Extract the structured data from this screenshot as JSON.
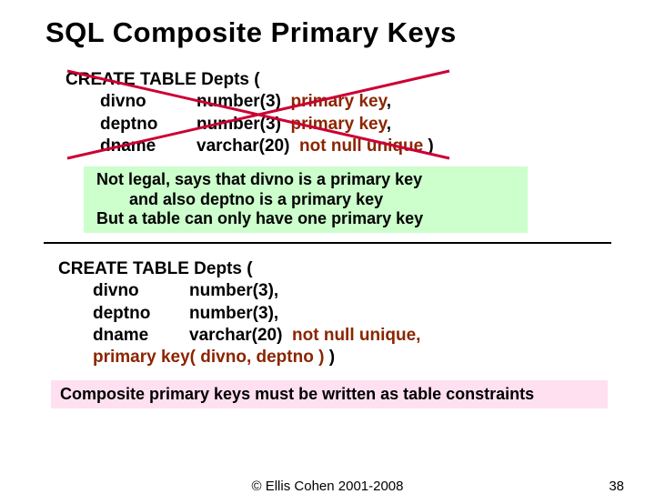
{
  "title": "SQL Composite Primary Keys",
  "block1": {
    "l1": "CREATE TABLE Depts (",
    "c1": "divno",
    "t1a": "number(3)",
    "t1b": "primary key",
    "t1c": ",",
    "c2": "deptno",
    "t2a": "number(3)",
    "t2b": "primary key",
    "t2c": ",",
    "c3": "dname",
    "t3a": "varchar(20)",
    "t3b": "not null  unique",
    "t3c": " )"
  },
  "note1_l1": "Not legal, says that divno is a primary key",
  "note1_l2": "and also deptno is a primary key",
  "note1_l3": "But a table can only have one primary key",
  "block2": {
    "l1": "CREATE TABLE Depts (",
    "c1": "divno",
    "t1": "number(3),",
    "c2": "deptno",
    "t2": "number(3),",
    "c3": "dname",
    "t3a": "varchar(20)",
    "t3b": "not null  unique,",
    "pk": "primary key( divno, deptno )",
    "pkend": " )"
  },
  "note2": "Composite primary keys must be written as table constraints",
  "copyright": "© Ellis Cohen 2001-2008",
  "page": "38"
}
